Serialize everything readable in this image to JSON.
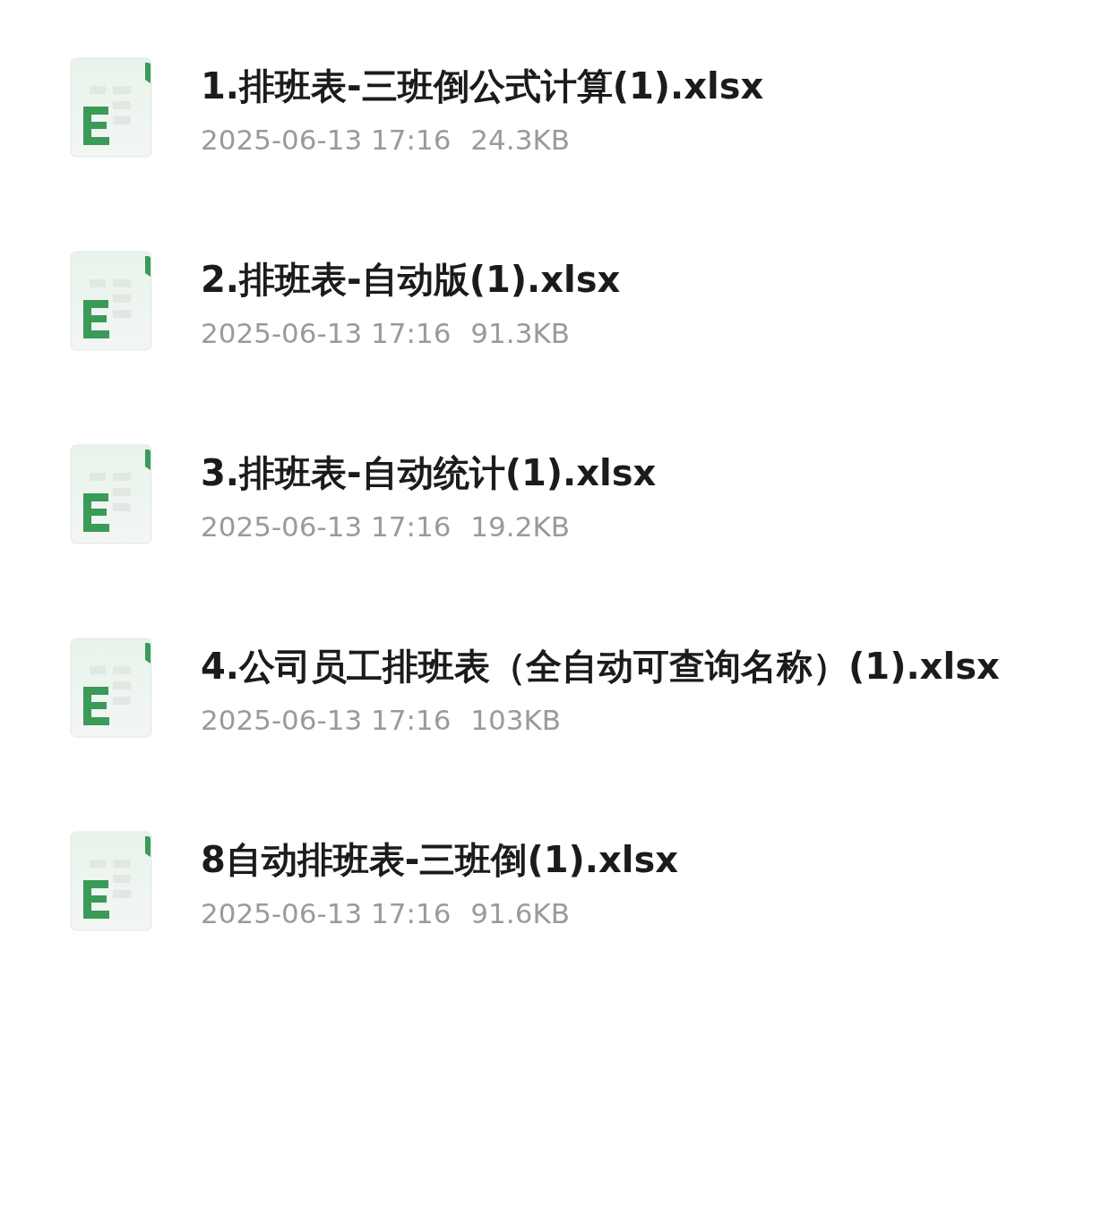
{
  "files": [
    {
      "name": "1.排班表-三班倒公式计算(1).xlsx",
      "date": "2025-06-13 17:16",
      "size": "24.3KB"
    },
    {
      "name": "2.排班表-自动版(1).xlsx",
      "date": "2025-06-13 17:16",
      "size": "91.3KB"
    },
    {
      "name": "3.排班表-自动统计(1).xlsx",
      "date": "2025-06-13 17:16",
      "size": "19.2KB"
    },
    {
      "name": "4.公司员工排班表（全自动可查询名称）(1).xlsx",
      "date": "2025-06-13 17:16",
      "size": "103KB"
    },
    {
      "name": "8自动排班表-三班倒(1).xlsx",
      "date": "2025-06-13 17:16",
      "size": "91.6KB"
    }
  ]
}
